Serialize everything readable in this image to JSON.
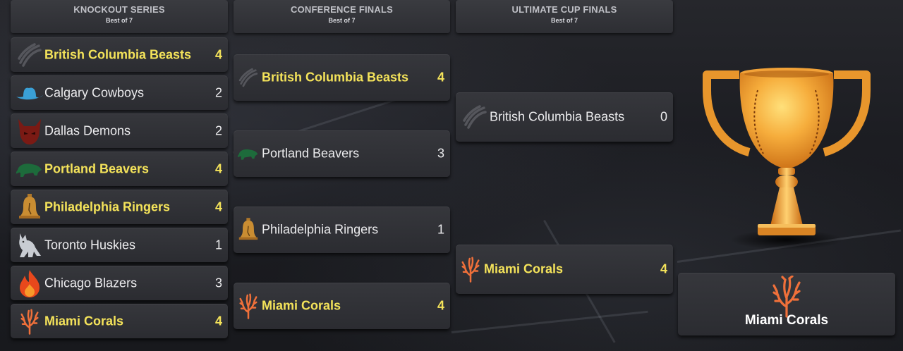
{
  "rounds": [
    {
      "title": "KNOCKOUT SERIES",
      "subtitle": "Best of 7"
    },
    {
      "title": "CONFERENCE FINALS",
      "subtitle": "Best of 7"
    },
    {
      "title": "ULTIMATE CUP FINALS",
      "subtitle": "Best of 7"
    }
  ],
  "knockout": [
    {
      "team": "British Columbia Beasts",
      "score": "4",
      "winner": true,
      "logo": "claw-marks-icon"
    },
    {
      "team": "Calgary Cowboys",
      "score": "2",
      "winner": false,
      "logo": "cowboy-hat-icon"
    },
    {
      "team": "Dallas Demons",
      "score": "2",
      "winner": false,
      "logo": "demon-head-icon"
    },
    {
      "team": "Portland Beavers",
      "score": "4",
      "winner": true,
      "logo": "beaver-icon"
    },
    {
      "team": "Philadelphia Ringers",
      "score": "4",
      "winner": true,
      "logo": "liberty-bell-icon"
    },
    {
      "team": "Toronto Huskies",
      "score": "1",
      "winner": false,
      "logo": "husky-dog-icon"
    },
    {
      "team": "Chicago Blazers",
      "score": "3",
      "winner": false,
      "logo": "flame-icon"
    },
    {
      "team": "Miami Corals",
      "score": "4",
      "winner": true,
      "logo": "coral-icon"
    }
  ],
  "conference": [
    {
      "team": "British Columbia Beasts",
      "score": "4",
      "winner": true,
      "logo": "claw-marks-icon"
    },
    {
      "team": "Portland Beavers",
      "score": "3",
      "winner": false,
      "logo": "beaver-icon"
    },
    {
      "team": "Philadelphia Ringers",
      "score": "1",
      "winner": false,
      "logo": "liberty-bell-icon"
    },
    {
      "team": "Miami Corals",
      "score": "4",
      "winner": true,
      "logo": "coral-icon"
    }
  ],
  "finals": [
    {
      "team": "British Columbia Beasts",
      "score": "0",
      "winner": false,
      "logo": "claw-marks-icon"
    },
    {
      "team": "Miami Corals",
      "score": "4",
      "winner": true,
      "logo": "coral-icon"
    }
  ],
  "champion": {
    "team": "Miami Corals",
    "logo": "coral-icon",
    "trophy": "trophy-icon"
  },
  "colors": {
    "winner_text": "#f4e35a",
    "normal_text": "#ececee",
    "card_bg": "#313237",
    "trophy_gold": "#f3a43a",
    "coral": "#f0703a"
  }
}
